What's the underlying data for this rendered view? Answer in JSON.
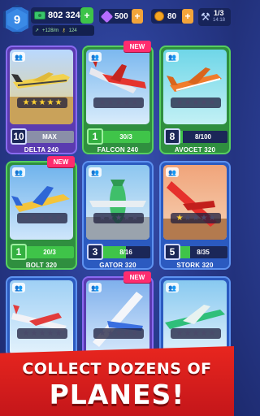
{
  "hud": {
    "level": "9",
    "money": "802 324",
    "money_plus": "+",
    "income": "+128/m",
    "keys": "124",
    "gems": "500",
    "coins": "80",
    "energy": "1/3",
    "energy_timer": "14:18",
    "plus": "+"
  },
  "colors": {
    "background": "#2a3d92",
    "progress_green": "#3fc449",
    "new_tag": "#ff2c6f",
    "banner_red": "#d81d1c",
    "star_on": "#ffd233"
  },
  "new_label": "NEW",
  "cards": [
    {
      "name": "DELTA 240",
      "level": "10",
      "progress_text": "MAX",
      "progress": 1.0,
      "stars": 5,
      "is_new": false,
      "upgradable": false
    },
    {
      "name": "FALCON 240",
      "level": "1",
      "progress_text": "30/3",
      "progress": 1.0,
      "stars": 0,
      "is_new": true,
      "upgradable": true
    },
    {
      "name": "AVOCET 320",
      "level": "8",
      "progress_text": "8/100",
      "progress": 0.08,
      "stars": 0,
      "is_new": false,
      "upgradable": false
    },
    {
      "name": "BOLT 320",
      "level": "1",
      "progress_text": "20/3",
      "progress": 1.0,
      "stars": 0,
      "is_new": true,
      "upgradable": true
    },
    {
      "name": "GATOR 320",
      "level": "3",
      "progress_text": "8/16",
      "progress": 0.5,
      "stars": 0,
      "is_new": false,
      "upgradable": false
    },
    {
      "name": "STORK 320",
      "level": "5",
      "progress_text": "8/35",
      "progress": 0.23,
      "stars": 1,
      "is_new": false,
      "upgradable": false
    },
    {
      "name": "",
      "stars": 0,
      "is_new": false
    },
    {
      "name": "",
      "stars": 0,
      "is_new": true
    },
    {
      "name": "",
      "stars": 0,
      "is_new": false
    }
  ],
  "banner": {
    "line1": "COLLECT DOZENS OF",
    "line2": "PLANES!"
  }
}
